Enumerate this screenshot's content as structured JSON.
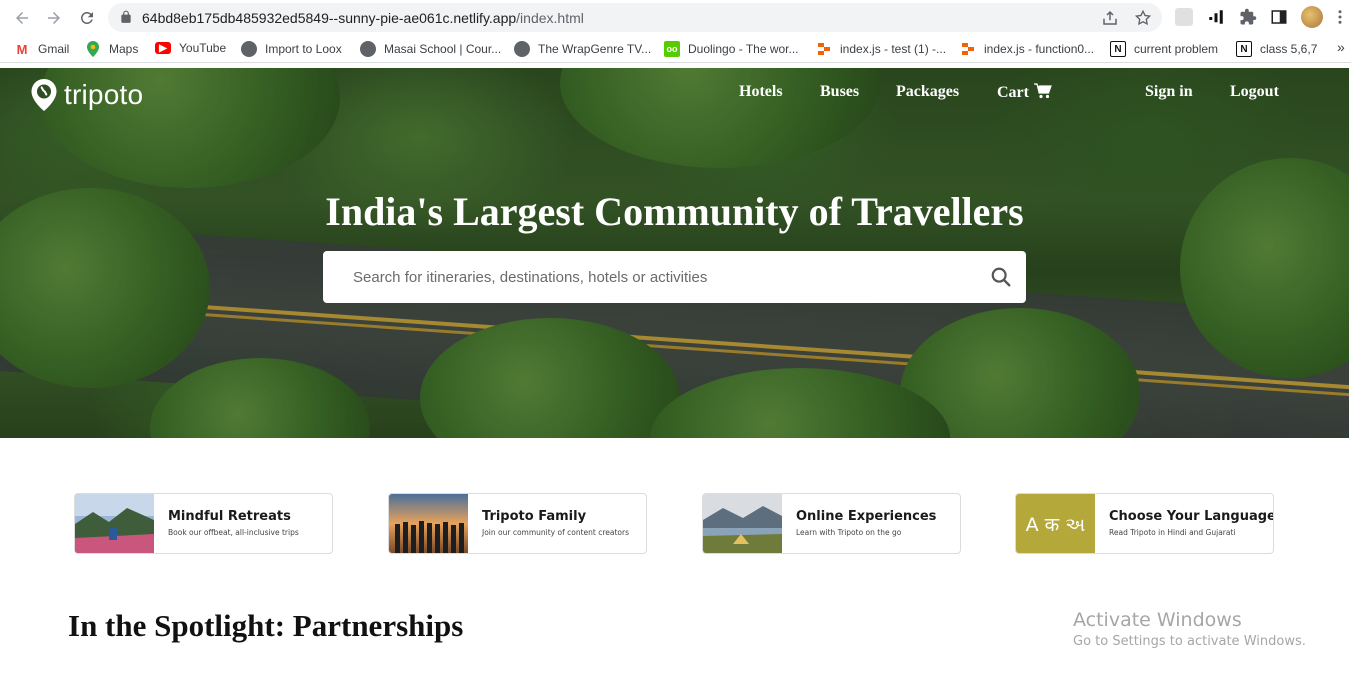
{
  "browser": {
    "url_main": "64bd8eb175db485932ed5849--sunny-pie-ae061c.netlify.app",
    "url_path": "/index.html",
    "bookmarks": [
      {
        "label": "Gmail",
        "icon": "gmail-icon"
      },
      {
        "label": "Maps",
        "icon": "maps-icon"
      },
      {
        "label": "YouTube",
        "icon": "youtube-icon"
      },
      {
        "label": "Import to Loox",
        "icon": "globe-icon"
      },
      {
        "label": "Masai School | Cour...",
        "icon": "globe-icon"
      },
      {
        "label": "The WrapGenre TV...",
        "icon": "globe-icon"
      },
      {
        "label": "Duolingo - The wor...",
        "icon": "duolingo-icon"
      },
      {
        "label": "index.js - test (1) -...",
        "icon": "replit-icon"
      },
      {
        "label": "index.js - function0...",
        "icon": "replit-icon"
      },
      {
        "label": "current problem",
        "icon": "notion-icon"
      },
      {
        "label": "class 5,6,7",
        "icon": "notion-icon"
      }
    ],
    "more_bookmarks": "»"
  },
  "site": {
    "logo": "tripoto",
    "nav": {
      "hotels": "Hotels",
      "buses": "Buses",
      "packages": "Packages",
      "cart": "Cart",
      "signin": "Sign in",
      "logout": "Logout"
    },
    "headline": "India's Largest Community of Travellers",
    "search_placeholder": "Search for itineraries, destinations, hotels or activities",
    "cards": [
      {
        "title": "Mindful Retreats",
        "subtitle": "Book our offbeat, all-inclusive trips"
      },
      {
        "title": "Tripoto Family",
        "subtitle": "Join our community of content creators"
      },
      {
        "title": "Online Experiences",
        "subtitle": "Learn with Tripoto on the go"
      },
      {
        "title": "Choose Your Language",
        "subtitle": "Read Tripoto in Hindi and Gujarati",
        "thumb_text": "A क અ"
      }
    ],
    "spotlight_heading": "In the Spotlight: Partnerships"
  },
  "watermark": {
    "line1": "Activate Windows",
    "line2": "Go to Settings to activate Windows."
  },
  "colors": {
    "brand_green": "#3b6a27",
    "language_tile": "#b5a83a"
  }
}
